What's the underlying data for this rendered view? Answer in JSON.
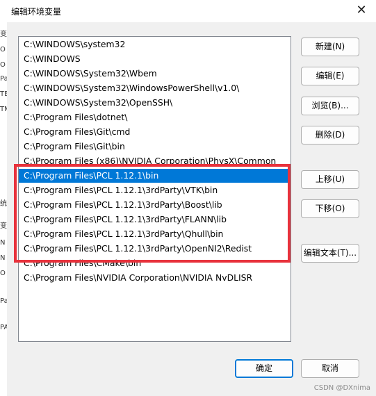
{
  "window": {
    "title": "编辑环境变量",
    "close_glyph": "✕"
  },
  "path_list": {
    "items": [
      "C:\\WINDOWS\\system32",
      "C:\\WINDOWS",
      "C:\\WINDOWS\\System32\\Wbem",
      "C:\\WINDOWS\\System32\\WindowsPowerShell\\v1.0\\",
      "C:\\WINDOWS\\System32\\OpenSSH\\",
      "C:\\Program Files\\dotnet\\",
      "C:\\Program Files\\Git\\cmd",
      "C:\\Program Files\\Git\\bin",
      "C:\\Program Files (x86)\\NVIDIA Corporation\\PhysX\\Common",
      "C:\\Program Files\\PCL 1.12.1\\bin",
      "C:\\Program Files\\PCL 1.12.1\\3rdParty\\VTK\\bin",
      "C:\\Program Files\\PCL 1.12.1\\3rdParty\\Boost\\lib",
      "C:\\Program Files\\PCL 1.12.1\\3rdParty\\FLANN\\lib",
      "C:\\Program Files\\PCL 1.12.1\\3rdParty\\Qhull\\bin",
      "C:\\Program Files\\PCL 1.12.1\\3rdParty\\OpenNI2\\Redist",
      "C:\\Program Files\\CMake\\bin",
      "C:\\Program Files\\NVIDIA Corporation\\NVIDIA NvDLISR"
    ],
    "selected_index": 9
  },
  "buttons": {
    "new": "新建(N)",
    "edit": "编辑(E)",
    "browse": "浏览(B)...",
    "delete": "删除(D)",
    "move_up": "上移(U)",
    "move_down": "下移(O)",
    "edit_text": "编辑文本(T)...",
    "ok": "确定",
    "cancel": "取消"
  },
  "watermark": "CSDN @DXnima",
  "background_window": {
    "fragments": [
      "变",
      "O",
      "O",
      "Pa",
      "TE",
      "TM",
      "统",
      "变",
      "N",
      "N",
      "O",
      "Pa",
      "PA"
    ]
  },
  "colors": {
    "selection": "#0078d7",
    "annotation_box": "#e8323c"
  }
}
